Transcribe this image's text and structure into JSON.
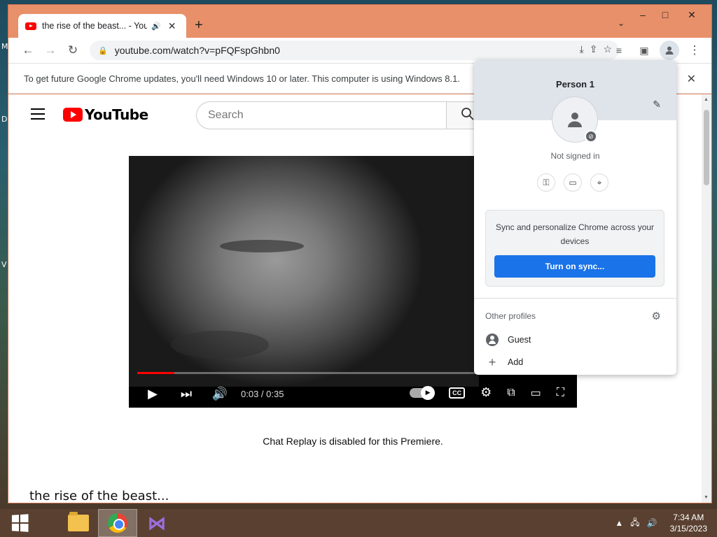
{
  "desktop": {
    "letters": [
      "M",
      "D",
      "V"
    ]
  },
  "window": {
    "minimize": "–",
    "maximize": "□",
    "close": "✕"
  },
  "tab": {
    "title": "the rise of the beast... - YouTube",
    "speaker_icon": "speaker-icon",
    "close": "✕"
  },
  "new_tab": "+",
  "tab_search": "⌄",
  "toolbar": {
    "back": "←",
    "forward": "→",
    "reload": "↻",
    "url": "youtube.com/watch?v=pFQFspGhbn0",
    "menu": "⋮"
  },
  "infobar": {
    "message": "To get future Google Chrome updates, you'll need Windows 10 or later. This computer is using Windows 8.1.",
    "close": "✕"
  },
  "youtube": {
    "logo_text": "YouTube",
    "search_placeholder": "Search",
    "search_icon": "⌕"
  },
  "video": {
    "time": "0:03 / 0:35",
    "progress_fraction": 0.086
  },
  "chat_message": "Chat Replay is disabled for this Premiere.",
  "video_title": "the rise of the beast...",
  "profile_menu": {
    "name": "Person 1",
    "status": "Not signed in",
    "sync_text": "Sync and personalize Chrome across your devices",
    "sync_button": "Turn on sync...",
    "other_profiles_label": "Other profiles",
    "profiles": [
      {
        "label": "Guest",
        "icon": "guest-icon"
      },
      {
        "label": "Add",
        "icon": "plus-icon"
      }
    ]
  },
  "taskbar": {
    "time": "7:34 AM",
    "date": "3/15/2023"
  },
  "colors": {
    "window_frame": "#e8906a",
    "youtube_red": "#ff0000",
    "sync_button": "#1a73e8",
    "profile_header": "#dfe4ea"
  }
}
